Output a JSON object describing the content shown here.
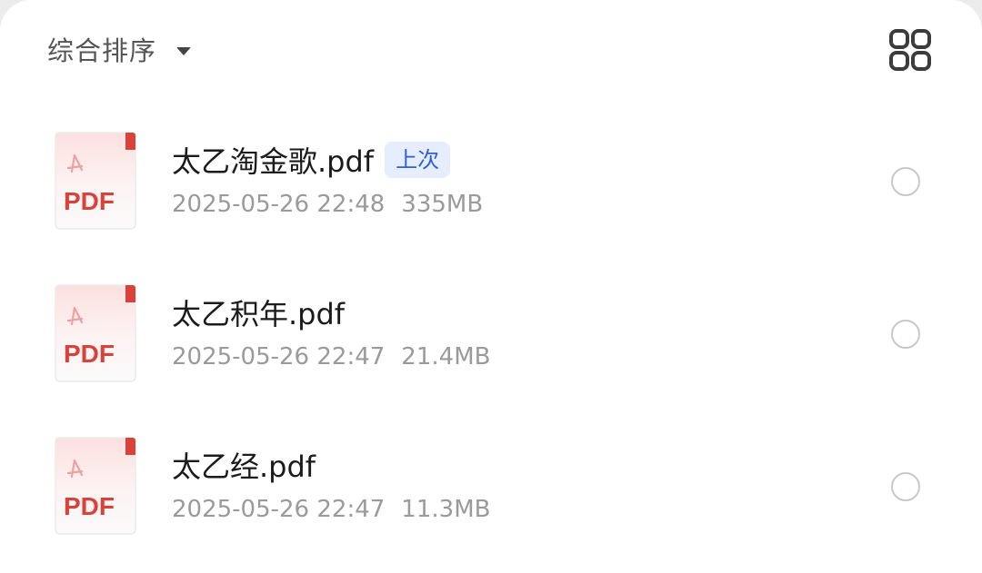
{
  "toolbar": {
    "sort_label": "综合排序",
    "sort_icon": "caret-down-icon",
    "view_toggle_icon": "grid-view-icon"
  },
  "colors": {
    "pdf_red": "#d9413b",
    "pdf_light": "#fbe3e2",
    "badge_bg": "#e6edfd",
    "badge_text": "#2f5fd8"
  },
  "files": [
    {
      "icon_label": "PDF",
      "name": "太乙淘金歌.pdf",
      "badge": "上次",
      "datetime": "2025-05-26 22:48",
      "size": "335MB"
    },
    {
      "icon_label": "PDF",
      "name": "太乙积年.pdf",
      "badge": "",
      "datetime": "2025-05-26 22:47",
      "size": "21.4MB"
    },
    {
      "icon_label": "PDF",
      "name": "太乙经.pdf",
      "badge": "",
      "datetime": "2025-05-26 22:47",
      "size": "11.3MB"
    }
  ]
}
